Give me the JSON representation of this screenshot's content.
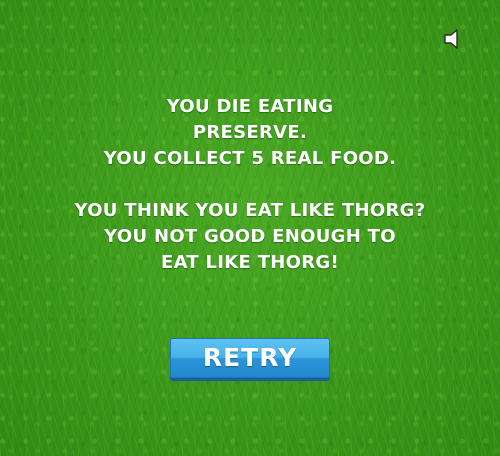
{
  "message": {
    "lines": [
      "YOU DIE EATING",
      "PRESERVE.",
      "YOU COLLECT 5 REAL FOOD.",
      "",
      "YOU THINK YOU EAT LIKE THORG?",
      "YOU NOT GOOD ENOUGH TO",
      "EAT LIKE THORG!"
    ]
  },
  "retry_button": {
    "label": "RETRY"
  },
  "sound": {
    "icon": "speaker-icon"
  },
  "colors": {
    "grass": "#3e9b1c",
    "text": "#ffffff",
    "button": "#47b2ea"
  }
}
